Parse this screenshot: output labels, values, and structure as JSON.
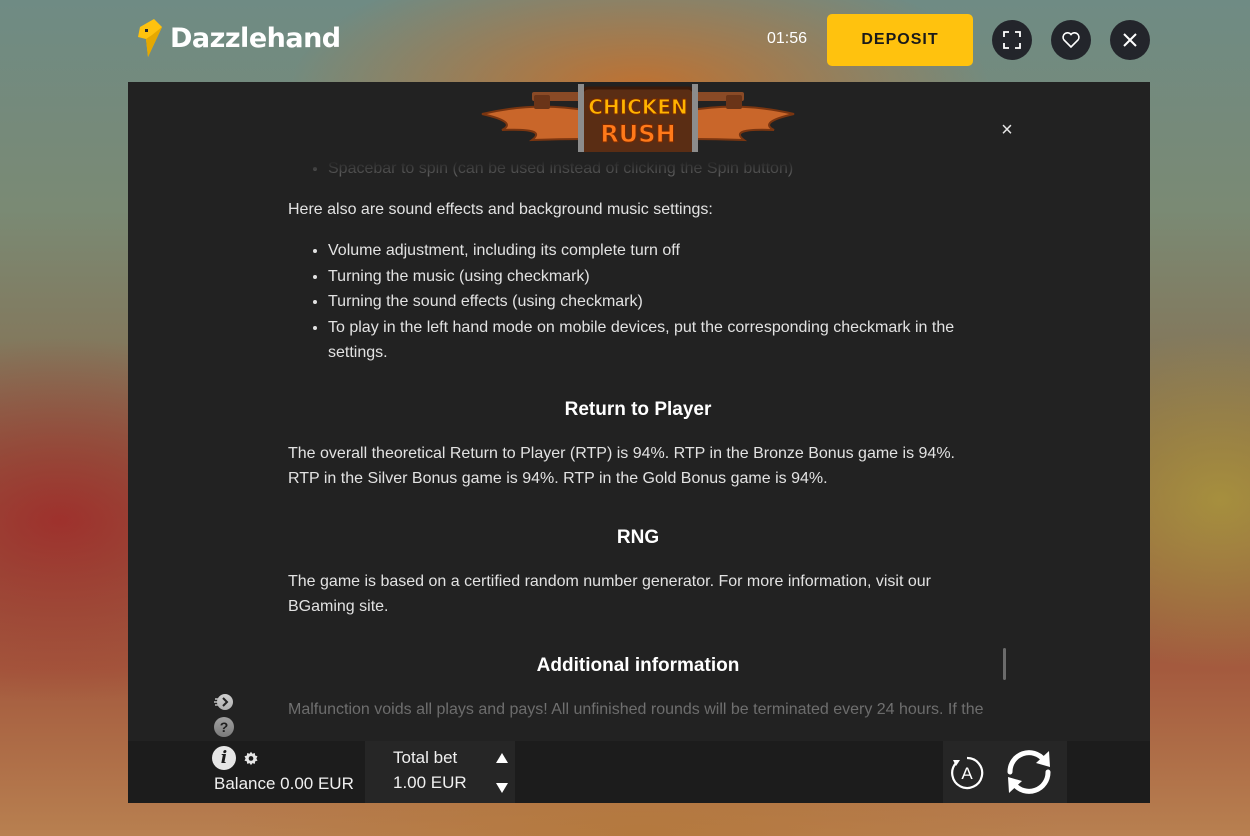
{
  "header": {
    "brand": "Dazzlehand",
    "timer": "01:56",
    "deposit_label": "DEPOSIT",
    "buttons": [
      "fullscreen-icon",
      "heart-icon",
      "close-icon"
    ]
  },
  "game": {
    "title_line1": "CHICKEN",
    "title_line2": "RUSH",
    "close_symbol": "×",
    "rules": {
      "partial_item": "Spacebar to spin (can be used instead of clicking the Spin button)",
      "sound_intro": "Here also are sound effects and background music settings:",
      "sound_items": [
        "Volume adjustment, including its complete turn off",
        "Turning the music (using checkmark)",
        "Turning the sound effects (using checkmark)",
        "To play in the left hand mode on mobile devices, put the corresponding checkmark in the settings."
      ],
      "rtp_heading": "Return to Player",
      "rtp_text": "The overall theoretical Return to Player (RTP) is 94%. RTP in the Bronze Bonus game is 94%. RTP in the Silver Bonus game is 94%. RTP in the Gold Bonus game is 94%.",
      "rng_heading": "RNG",
      "rng_text": "The game is based on a certified random number generator. For more information, visit our BGaming site.",
      "additional_heading": "Additional information",
      "additional_text": "Malfunction voids all plays and pays! All unfinished rounds will be terminated every 24 hours. If the"
    }
  },
  "controls": {
    "balance": "Balance 0.00 EUR",
    "total_bet_label": "Total bet",
    "total_bet_value": "1.00 EUR",
    "auto_label": "A",
    "info_label": "i",
    "help_label": "?"
  },
  "colors": {
    "accent": "#ffc20e",
    "panel": "#222222",
    "bar": "#1c1c1c"
  }
}
